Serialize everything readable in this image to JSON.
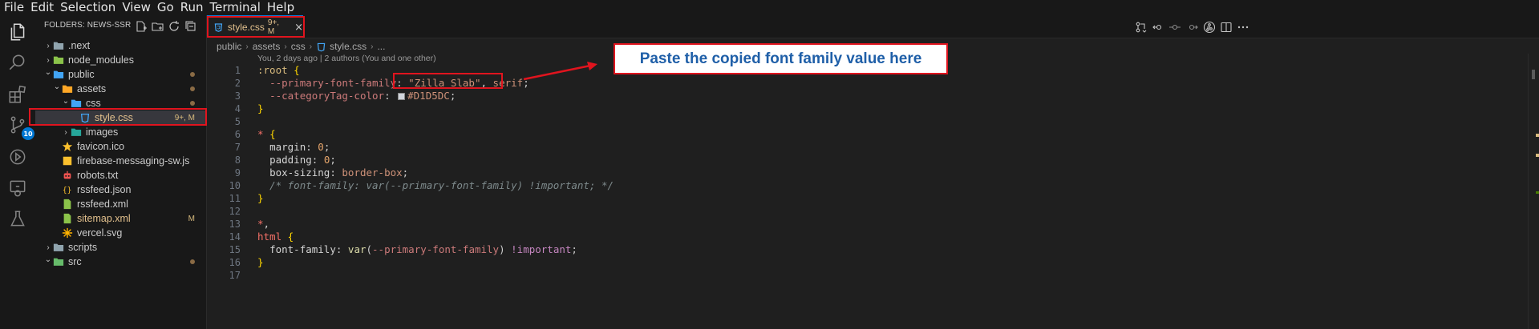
{
  "menu": [
    "File",
    "Edit",
    "Selection",
    "View",
    "Go",
    "Run",
    "Terminal",
    "Help"
  ],
  "activity_bar": {
    "items": [
      "explorer-icon",
      "search-icon",
      "extensions-icon",
      "source-control-icon",
      "run-debug-icon",
      "remote-explorer-icon",
      "testing-icon"
    ],
    "source_control_badge": "10"
  },
  "sidebar": {
    "title": "FOLDERS: NEWS-SSR",
    "actions": [
      "new-file-icon",
      "new-folder-icon",
      "refresh-icon",
      "collapse-all-icon"
    ],
    "tree": [
      {
        "label": ".next",
        "type": "folder",
        "expanded": false,
        "depth": 0
      },
      {
        "label": "node_modules",
        "type": "folder",
        "expanded": false,
        "depth": 0
      },
      {
        "label": "public",
        "type": "folder",
        "expanded": true,
        "depth": 0,
        "modified_dot": true
      },
      {
        "label": "assets",
        "type": "folder",
        "expanded": true,
        "depth": 1,
        "modified_dot": true
      },
      {
        "label": "css",
        "type": "folder",
        "expanded": true,
        "depth": 2,
        "modified_dot": true
      },
      {
        "label": "style.css",
        "type": "css",
        "depth": 3,
        "status": "9+, M",
        "selected": true
      },
      {
        "label": "images",
        "type": "folder",
        "expanded": false,
        "depth": 2
      },
      {
        "label": "favicon.ico",
        "type": "ico",
        "depth": 1
      },
      {
        "label": "firebase-messaging-sw.js",
        "type": "js",
        "depth": 1
      },
      {
        "label": "robots.txt",
        "type": "txt",
        "depth": 1
      },
      {
        "label": "rssfeed.json",
        "type": "json",
        "depth": 1
      },
      {
        "label": "rssfeed.xml",
        "type": "xml",
        "depth": 1
      },
      {
        "label": "sitemap.xml",
        "type": "xml",
        "depth": 1,
        "status": "M"
      },
      {
        "label": "vercel.svg",
        "type": "svg",
        "depth": 1
      },
      {
        "label": "scripts",
        "type": "folder",
        "expanded": false,
        "depth": 0
      },
      {
        "label": "src",
        "type": "folder",
        "expanded": true,
        "depth": 0,
        "modified_dot": true
      }
    ]
  },
  "editor": {
    "tab": {
      "label": "style.css",
      "status": "9+, M",
      "close": "×"
    },
    "breadcrumb": [
      "public",
      "assets",
      "css",
      "style.css",
      "..."
    ],
    "codelens": "You, 2 days ago | 2 authors (You and one other)",
    "lines": [
      {
        "n": "1",
        "tokens": [
          [
            ":root",
            "c-sel"
          ],
          [
            " ",
            "c-plain"
          ],
          [
            "{",
            "c-brace"
          ]
        ]
      },
      {
        "n": "2",
        "tokens": [
          [
            "  ",
            "c-plain"
          ],
          [
            "--primary-font-family",
            "c-var"
          ],
          [
            ": ",
            "c-punc"
          ],
          [
            "\"Zilla Slab\"",
            "c-str"
          ],
          [
            ", ",
            "c-punc"
          ],
          [
            "serif",
            "c-val"
          ],
          [
            ";",
            "c-punc"
          ]
        ]
      },
      {
        "n": "3",
        "tokens": [
          [
            "  ",
            "c-plain"
          ],
          [
            "--categoryTag-color",
            "c-var"
          ],
          [
            ": ",
            "c-punc"
          ],
          [
            "#SWATCH#",
            "swatch"
          ],
          [
            "#D1D5DC",
            "c-val"
          ],
          [
            ";",
            "c-punc"
          ]
        ]
      },
      {
        "n": "4",
        "tokens": [
          [
            "}",
            "c-brace"
          ]
        ]
      },
      {
        "n": "5",
        "tokens": []
      },
      {
        "n": "6",
        "tokens": [
          [
            "*",
            "c-tag"
          ],
          [
            " ",
            "c-plain"
          ],
          [
            "{",
            "c-brace"
          ]
        ]
      },
      {
        "n": "7",
        "tokens": [
          [
            "  ",
            "c-plain"
          ],
          [
            "margin",
            "c-plain"
          ],
          [
            ": ",
            "c-punc"
          ],
          [
            "0",
            "c-num"
          ],
          [
            ";",
            "c-punc"
          ]
        ]
      },
      {
        "n": "8",
        "tokens": [
          [
            "  ",
            "c-plain"
          ],
          [
            "padding",
            "c-plain"
          ],
          [
            ": ",
            "c-punc"
          ],
          [
            "0",
            "c-num"
          ],
          [
            ";",
            "c-punc"
          ]
        ]
      },
      {
        "n": "9",
        "tokens": [
          [
            "  ",
            "c-plain"
          ],
          [
            "box-sizing",
            "c-plain"
          ],
          [
            ": ",
            "c-punc"
          ],
          [
            "border-box",
            "c-val"
          ],
          [
            ";",
            "c-punc"
          ]
        ]
      },
      {
        "n": "10",
        "tokens": [
          [
            "  ",
            "c-plain"
          ],
          [
            "/* font-family: var(--primary-font-family) !important; */",
            "c-com"
          ]
        ]
      },
      {
        "n": "11",
        "tokens": [
          [
            "}",
            "c-brace"
          ]
        ]
      },
      {
        "n": "12",
        "tokens": []
      },
      {
        "n": "13",
        "tokens": [
          [
            "*",
            "c-tag"
          ],
          [
            ",",
            "c-punc"
          ]
        ]
      },
      {
        "n": "14",
        "tokens": [
          [
            "html",
            "c-tag"
          ],
          [
            " ",
            "c-plain"
          ],
          [
            "{",
            "c-brace"
          ]
        ]
      },
      {
        "n": "15",
        "tokens": [
          [
            "  ",
            "c-plain"
          ],
          [
            "font-family",
            "c-plain"
          ],
          [
            ": ",
            "c-punc"
          ],
          [
            "var",
            "c-fn"
          ],
          [
            "(",
            "c-punc"
          ],
          [
            "--primary-font-family",
            "c-var"
          ],
          [
            ") ",
            "c-punc"
          ],
          [
            "!important",
            "c-kw"
          ],
          [
            ";",
            "c-punc"
          ]
        ]
      },
      {
        "n": "16",
        "tokens": [
          [
            "}",
            "c-brace"
          ]
        ]
      },
      {
        "n": "17",
        "tokens": []
      }
    ]
  },
  "annotation": {
    "callout_text": "Paste the copied font family value here",
    "color": "#e0141e"
  },
  "colors": {
    "accent": "#0078d4",
    "git_modified": "#e2c08d",
    "annotation_red": "#e0141e",
    "callout_text": "#1f5fa8"
  }
}
